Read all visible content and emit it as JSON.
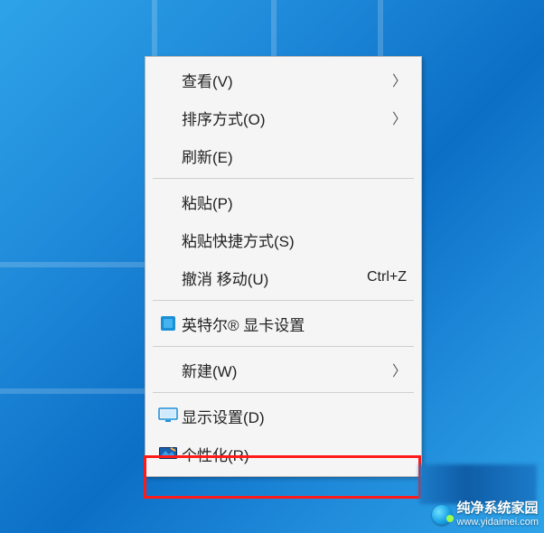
{
  "menu": {
    "view": {
      "label": "查看(V)",
      "has_submenu": true
    },
    "sort": {
      "label": "排序方式(O)",
      "has_submenu": true
    },
    "refresh": {
      "label": "刷新(E)"
    },
    "paste": {
      "label": "粘贴(P)"
    },
    "paste_shortcut": {
      "label": "粘贴快捷方式(S)"
    },
    "undo_move": {
      "label": "撤消 移动(U)",
      "shortcut": "Ctrl+Z"
    },
    "intel_gfx": {
      "label": "英特尔® 显卡设置"
    },
    "new": {
      "label": "新建(W)",
      "has_submenu": true
    },
    "display_settings": {
      "label": "显示设置(D)"
    },
    "personalize": {
      "label": "个性化(R)"
    }
  },
  "watermark": {
    "brand": "纯净系统家园",
    "url": "www.yidaimei.com"
  }
}
